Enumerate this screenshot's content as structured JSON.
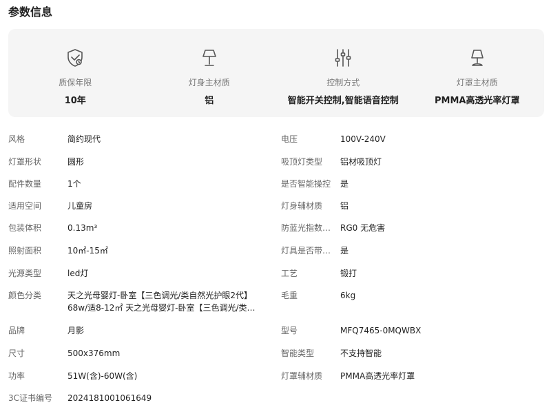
{
  "page_title": "参数信息",
  "highlights": [
    {
      "icon": "shield-check-icon",
      "label": "质保年限",
      "value": "10年"
    },
    {
      "icon": "lamp-icon",
      "label": "灯身主材质",
      "value": "铝"
    },
    {
      "icon": "sliders-icon",
      "label": "控制方式",
      "value": "智能开关控制,智能语音控制"
    },
    {
      "icon": "lamp-shade-icon",
      "label": "灯罩主材质",
      "value": "PMMA高透光率灯罩"
    }
  ],
  "params_left": [
    {
      "label": "风格",
      "value": "简约现代"
    },
    {
      "label": "灯罩形状",
      "value": "圆形"
    },
    {
      "label": "配件数量",
      "value": "1个"
    },
    {
      "label": "适用空间",
      "value": "儿童房"
    },
    {
      "label": "包装体积",
      "value": "0.13m³"
    },
    {
      "label": "照射面积",
      "value": "10㎡-15㎡"
    },
    {
      "label": "光源类型",
      "value": "led灯"
    },
    {
      "label": "颜色分类",
      "value": "天之光母婴灯-卧室【三色调光/类自然光护眼2代】68w/适8-12㎡ 天之光母婴灯-卧室【三色调光/类…"
    },
    {
      "label": "品牌",
      "value": "月影"
    },
    {
      "label": "尺寸",
      "value": "500x376mm"
    },
    {
      "label": "功率",
      "value": "51W(含)-60W(含)"
    },
    {
      "label": "3C证书编号",
      "value": "2024181001061649"
    }
  ],
  "params_right": [
    {
      "label": "电压",
      "value": "100V-240V"
    },
    {
      "label": "吸顶灯类型",
      "value": "铝材吸顶灯"
    },
    {
      "label": "是否智能操控",
      "value": "是"
    },
    {
      "label": "灯身辅材质",
      "value": "铝"
    },
    {
      "label": "防蓝光指数…",
      "value": "RG0 无危害"
    },
    {
      "label": "灯具是否带…",
      "value": "是"
    },
    {
      "label": "工艺",
      "value": "锻打"
    },
    {
      "label": "毛重",
      "value": "6kg"
    },
    {
      "label": "型号",
      "value": "MFQ7465-0MQWBX"
    },
    {
      "label": "智能类型",
      "value": "不支持智能"
    },
    {
      "label": "灯罩辅材质",
      "value": "PMMA高透光率灯罩"
    }
  ],
  "colors": {
    "panel_bg": "#f5f5f5",
    "label": "#666666",
    "value": "#222222",
    "icon": "#555555"
  }
}
